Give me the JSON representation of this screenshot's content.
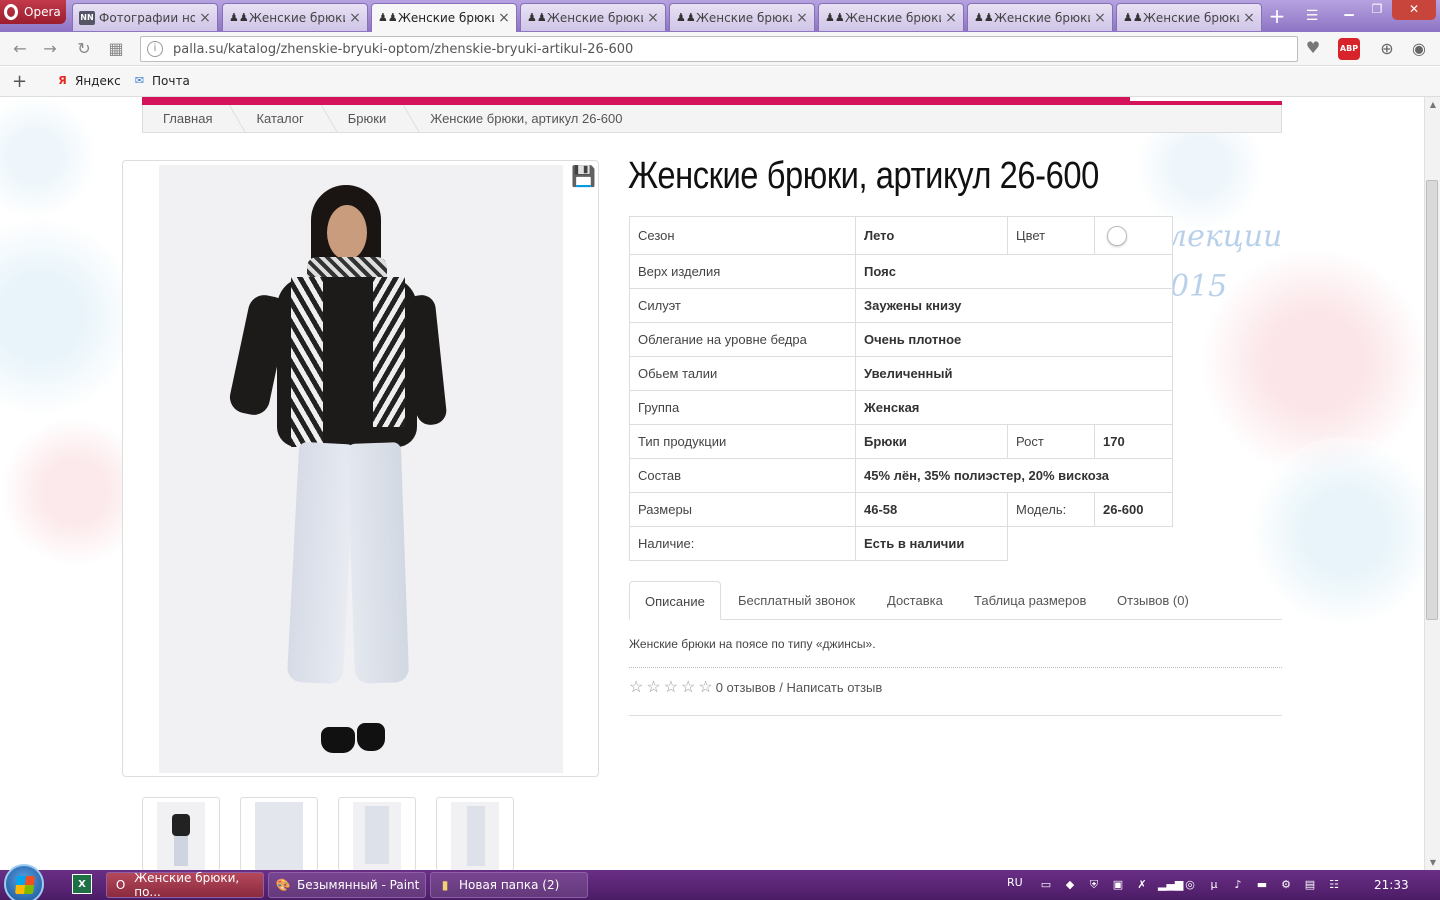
{
  "browser": {
    "app_name": "Opera",
    "tabs": [
      {
        "label": "Фотографии нов",
        "icon": "nn-icon",
        "active": false
      },
      {
        "label": "Женские брюки",
        "icon": "figures-icon",
        "active": false
      },
      {
        "label": "Женские брюки,",
        "icon": "figures-icon",
        "active": true
      },
      {
        "label": "Женские брюки,",
        "icon": "figures-icon",
        "active": false
      },
      {
        "label": "Женские брюки,",
        "icon": "figures-icon",
        "active": false
      },
      {
        "label": "Женские брюки,",
        "icon": "figures-icon",
        "active": false
      },
      {
        "label": "Женские брюки,",
        "icon": "figures-icon",
        "active": false
      },
      {
        "label": "Женские брюки,",
        "icon": "figures-icon",
        "active": false
      }
    ],
    "url": "palla.su/katalog/zhenskie-bryuki-optom/zhenskie-bryuki-artikul-26-600",
    "abp_label": "ABP",
    "bookmarks": [
      {
        "label": "Яндекс",
        "icon": "yandex-icon"
      },
      {
        "label": "Почта",
        "icon": "mail-icon"
      }
    ]
  },
  "page": {
    "breadcrumb": [
      "Главная",
      "Каталог",
      "Брюки",
      "Женские брюки, артикул 26-600"
    ],
    "title": "Женские брюки, артикул 26-600",
    "watermark": [
      "лекции",
      "015"
    ],
    "specs": {
      "season_label": "Сезон",
      "season_value": "Лето",
      "color_label": "Цвет",
      "top_label": "Верх изделия",
      "top_value": "Пояс",
      "silhouette_label": "Силуэт",
      "silhouette_value": "Заужены книзу",
      "hip_label": "Облегание на уровне бедра",
      "hip_value": "Очень плотное",
      "waist_label": "Обьем талии",
      "waist_value": "Увеличенный",
      "group_label": "Группа",
      "group_value": "Женская",
      "type_label": "Тип продукции",
      "type_value": "Брюки",
      "height_label": "Рост",
      "height_value": "170",
      "composition_label": "Состав",
      "composition_value": "45% лён, 35% полиэстер, 20% вискоза",
      "sizes_label": "Размеры",
      "sizes_value": "46-58",
      "model_label": "Модель:",
      "model_value": "26-600",
      "availability_label": "Наличие:",
      "availability_value": "Есть в наличии"
    },
    "tabs": [
      "Описание",
      "Бесплатный звонок",
      "Доставка",
      "Таблица размеров",
      "Отзывов (0)"
    ],
    "description": "Женские брюки на поясе по типу «джинсы».",
    "rating": {
      "stars": 5,
      "filled": 0,
      "text": "0 отзывов / Написать отзыв"
    }
  },
  "taskbar": {
    "items": [
      {
        "label": "Женские брюки, по...",
        "icon": "opera-icon",
        "active": true
      },
      {
        "label": "Безымянный - Paint",
        "icon": "paint-icon",
        "active": false
      },
      {
        "label": "Новая папка (2)",
        "icon": "folder-icon",
        "active": false
      }
    ],
    "lang": "RU",
    "time": "21:33"
  },
  "colors": {
    "accent": "#d4145a",
    "taskbar": "#5a2577",
    "tabbar": "#9f86d0"
  }
}
